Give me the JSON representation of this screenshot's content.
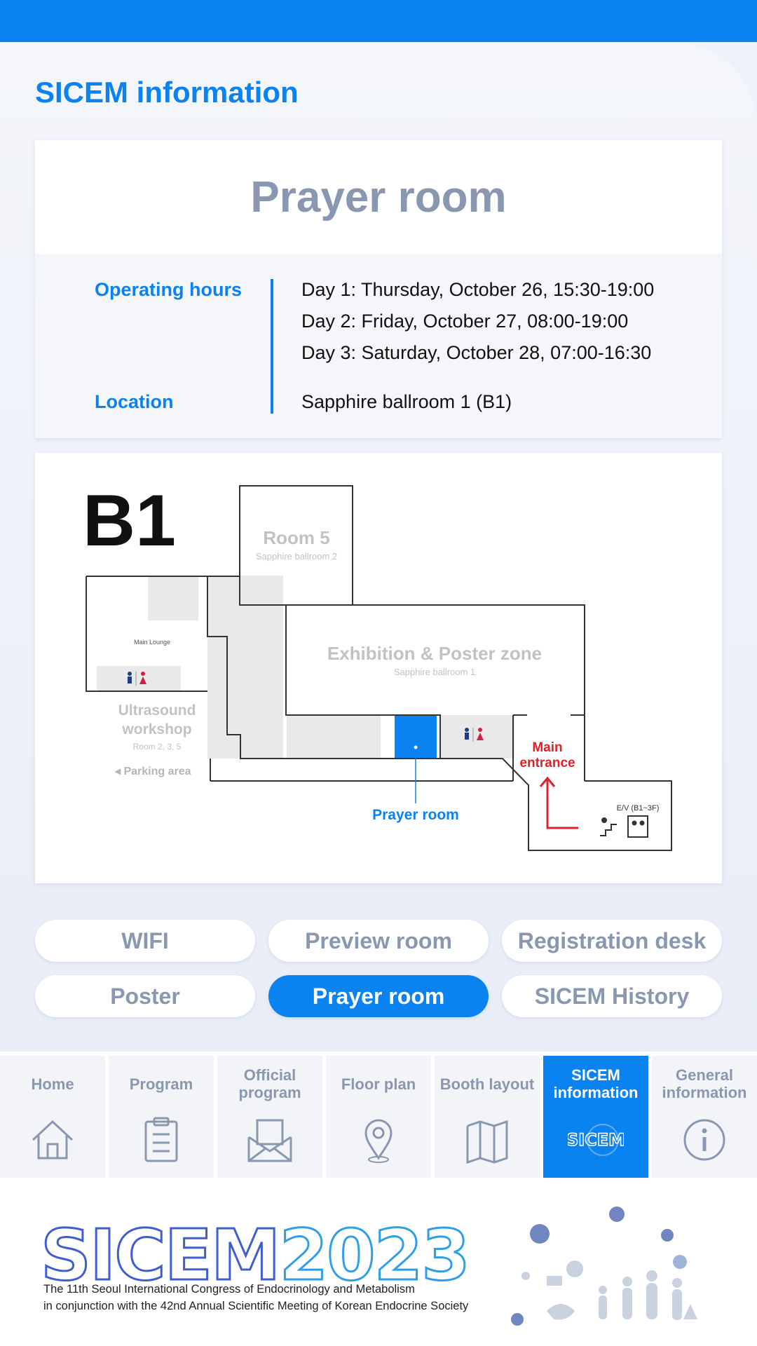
{
  "page_title": "SICEM information",
  "card": {
    "title": "Prayer room",
    "hours_label": "Operating hours",
    "hours": [
      "Day 1: Thursday, October 26, 15:30-19:00",
      "Day 2: Friday, October 27, 08:00-19:00",
      "Day 3: Saturday, October 28, 07:00-16:30"
    ],
    "location_label": "Location",
    "location": "Sapphire ballroom 1 (B1)"
  },
  "map": {
    "floor": "B1",
    "room5": "Room 5",
    "room5_sub": "Sapphire ballroom 2",
    "main_lounge": "Main Lounge",
    "exhibition": "Exhibition & Poster zone",
    "exhibition_sub": "Sapphire ballroom 1",
    "ultrasound_1": "Ultrasound",
    "ultrasound_2": "workshop",
    "ultrasound_sub": "Room 2, 3, 5",
    "parking": "◂ Parking area",
    "main_entrance_1": "Main",
    "main_entrance_2": "entrance",
    "elevator": "E/V (B1~3F)",
    "prayer_room": "Prayer room"
  },
  "tabs": [
    {
      "label": "WIFI"
    },
    {
      "label": "Preview room"
    },
    {
      "label": "Registration desk"
    },
    {
      "label": "Poster"
    },
    {
      "label": "Prayer room",
      "active": true
    },
    {
      "label": "SICEM History"
    }
  ],
  "nav": [
    {
      "label": "Home",
      "icon": "home-icon"
    },
    {
      "label": "Program",
      "icon": "clipboard-icon"
    },
    {
      "label": "Official program",
      "icon": "envelope-icon"
    },
    {
      "label": "Floor plan",
      "icon": "location-pin-icon"
    },
    {
      "label": "Booth layout",
      "icon": "map-icon"
    },
    {
      "label": "SICEM information",
      "icon": "sicem-logo-icon",
      "active": true
    },
    {
      "label": "General information",
      "icon": "info-icon"
    }
  ],
  "footer": {
    "brand": "SICEM",
    "year": "2023",
    "tagline_1": "The 11th Seoul International Congress of Endocrinology and Metabolism",
    "tagline_2": "in conjunction with the 42nd Annual Scientific Meeting of Korean Endocrine Society"
  },
  "colors": {
    "accent": "#0a82f0",
    "muted": "#8a97b0",
    "entrance_red": "#e0202a"
  }
}
